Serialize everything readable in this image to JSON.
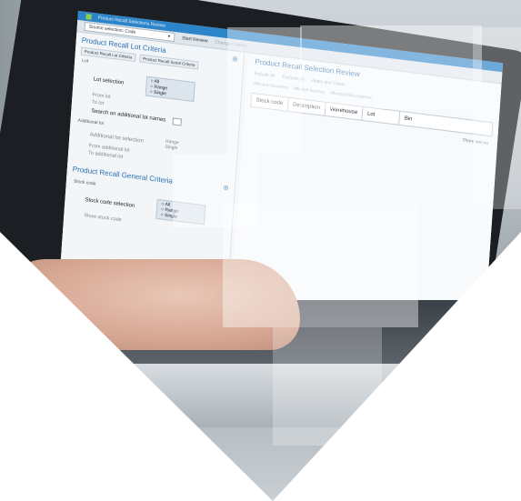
{
  "window": {
    "title": "Product Recall Selections Review"
  },
  "toolbar": {
    "selection_value": "Source selection: Code",
    "start_review": "Start Review",
    "change_criteria": "Change Criteria"
  },
  "lot_criteria": {
    "title": "Product Recall Lot Criteria",
    "tabs": [
      "Product Recall Lot Criteria",
      "Product Recall Serial Criteria"
    ],
    "group": "Lot",
    "lot_selection_label": "Lot selection",
    "lot_selection_options": [
      "All",
      "Range",
      "Single"
    ],
    "from_lot": "From lot",
    "to_lot": "To lot",
    "search_additional": "Search on additional lot names",
    "additional_group": "Additional lot",
    "additional_selection": "Additional lot selection",
    "additional_options": [
      "Range",
      "Single"
    ],
    "from_additional": "From additional lot",
    "to_additional": "To additional lot"
  },
  "general_criteria": {
    "title": "Product Recall General Criteria",
    "group": "Stock code",
    "stock_selection": "Stock code selection",
    "stock_options": [
      "All",
      "Range",
      "Single"
    ],
    "show_stock": "Show stock code"
  },
  "review": {
    "title": "Product Recall Selection Review",
    "buttons": [
      "Include All",
      "Exclude All",
      "Apply and Close"
    ],
    "subtabs": [
      "Affected Document",
      "Affected Sources",
      "Affected Data Columns"
    ],
    "columns": [
      "Stock code",
      "Description",
      "Warehouse",
      "Lot",
      "Bin"
    ],
    "empty_message": "There are no"
  },
  "colors": {
    "accent": "#2c84c9",
    "header_blue": "#2a6fb0"
  }
}
